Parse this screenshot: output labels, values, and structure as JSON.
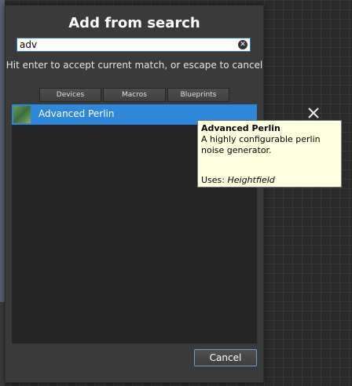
{
  "dialog": {
    "title": "Add from search",
    "search": {
      "value": "adv",
      "placeholder": ""
    },
    "hint": "Hit enter to accept current match, or escape to cancel",
    "tabs": [
      "Devices",
      "Macros",
      "Blueprints"
    ],
    "results": [
      {
        "label": "Advanced Perlin"
      }
    ],
    "cancel_label": "Cancel"
  },
  "tooltip": {
    "title": "Advanced Perlin",
    "description": "A highly configurable perlin noise generator.",
    "uses_label": "Uses: ",
    "uses_value": "Heightfield"
  },
  "colors": {
    "selection": "#2f87d9",
    "tooltip_bg": "#ffffe1"
  },
  "icons": {
    "clear": "clear-icon",
    "close": "close-icon",
    "thumbnail": "heightfield-thumbnail-icon"
  }
}
